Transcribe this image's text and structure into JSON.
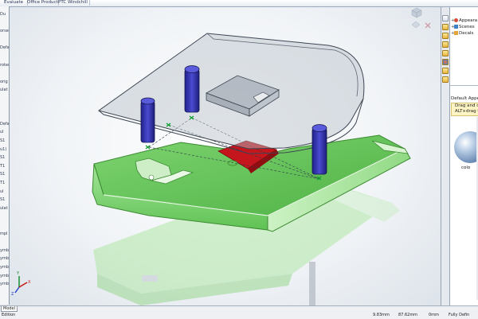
{
  "command_tabs": [
    "Evaluate",
    "Office Products",
    "PTC Windchill"
  ],
  "left_panel": {
    "rows": [
      "Du",
      "",
      "orse",
      "",
      "Defa",
      "",
      "rotec",
      "",
      "orig",
      "ulat",
      "",
      "",
      "",
      "Defa",
      "ul",
      "S1",
      "u1)",
      "S1",
      "T1",
      "S1",
      "T1",
      "ul",
      "S1",
      "ulat",
      "",
      "",
      "mpl",
      "",
      "ymb",
      "ymb",
      "ymb",
      "ymb",
      "ymb"
    ]
  },
  "viewport": {
    "triad_axes": [
      "Y",
      "X",
      "Z"
    ]
  },
  "task_pane": {
    "icons": [
      "home-icon",
      "parts-icon",
      "library-icon",
      "explorer-icon",
      "search-icon",
      "appearances-icon",
      "properties-icon"
    ]
  },
  "appearances_tree": {
    "items": [
      {
        "label": "Appeara",
        "icon": "appearances-icon",
        "color": "#d64b3a"
      },
      {
        "label": "Scenes",
        "icon": "scenes-icon",
        "color": "#3d7fc4"
      },
      {
        "label": "Decals",
        "icon": "decals-icon",
        "color": "#e2a33a"
      }
    ]
  },
  "gallery": {
    "title": "Default Appea",
    "hint_line1": "Drag and d",
    "hint_line2": "ALT+drag to in",
    "swatch_label": "colo"
  },
  "status_bar": {
    "document_tab": "Model",
    "mode": "Edition",
    "x_value": "9.83mm",
    "y_value": "87.62mm",
    "z_value": "0mm",
    "state": "Fully Defin"
  },
  "colors": {
    "green_body": "#67c95a",
    "green_edge": "#3c8a32",
    "glass": "#b6bec8",
    "pin": "#2e2f9e",
    "red_cavity": "#c4161c",
    "accent_yellow": "#f0c040"
  }
}
